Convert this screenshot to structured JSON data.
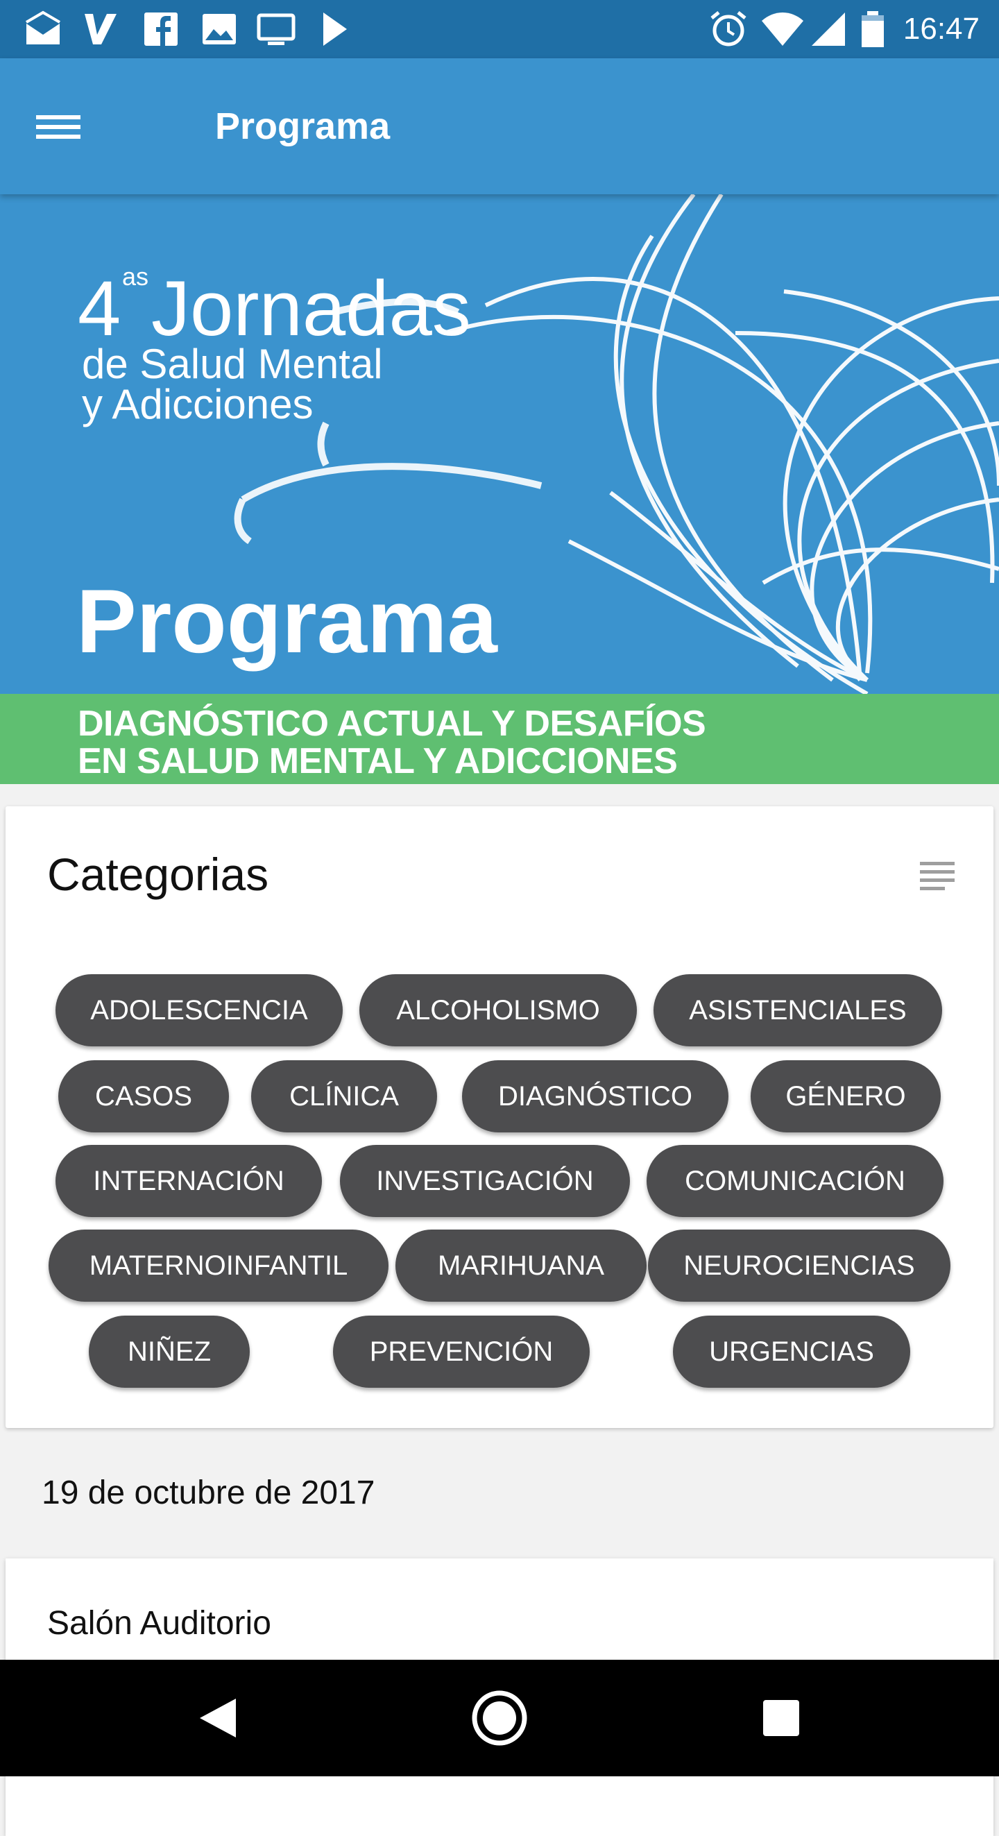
{
  "status_bar": {
    "time": "16:47",
    "left_icons": [
      "mail-check-icon",
      "vodafone-icon",
      "facebook-icon",
      "image-icon",
      "tv-icon",
      "play-store-icon"
    ],
    "right_icons": [
      "alarm-icon",
      "wifi-icon",
      "signal-icon",
      "battery-icon"
    ]
  },
  "app_bar": {
    "title": "Programa",
    "menu_icon": "hamburger-menu-icon"
  },
  "banner": {
    "jornadas_number": "4",
    "jornadas_superscript": "as",
    "jornadas_word": "Jornadas",
    "jornadas_line2": "de Salud Mental",
    "jornadas_line3": "y Adicciones",
    "program_title": "Programa",
    "subtitle_line1": "DIAGNÓSTICO ACTUAL Y DESAFÍOS",
    "subtitle_line2": "EN SALUD MENTAL Y ADICCIONES",
    "colors": {
      "blue": "#3b93ce",
      "green": "#5fbf71"
    }
  },
  "categories": {
    "title": "Categorias",
    "view_icon": "list-view-icon",
    "chips": [
      "ADOLESCENCIA",
      "ALCOHOLISMO",
      "ASISTENCIALES",
      "CASOS",
      "CLÍNICA",
      "DIAGNÓSTICO",
      "GÉNERO",
      "INTERNACIÓN",
      "INVESTIGACIÓN",
      "COMUNICACIÓN",
      "MATERNOINFANTIL",
      "MARIHUANA",
      "NEUROCIENCIAS",
      "NIÑEZ",
      "PREVENCIÓN",
      "URGENCIAS"
    ]
  },
  "schedule": {
    "date": "19 de octubre de 2017",
    "venue": "Salón Auditorio"
  },
  "nav_bar": {
    "buttons": [
      "back-icon",
      "home-icon",
      "recents-icon"
    ]
  }
}
